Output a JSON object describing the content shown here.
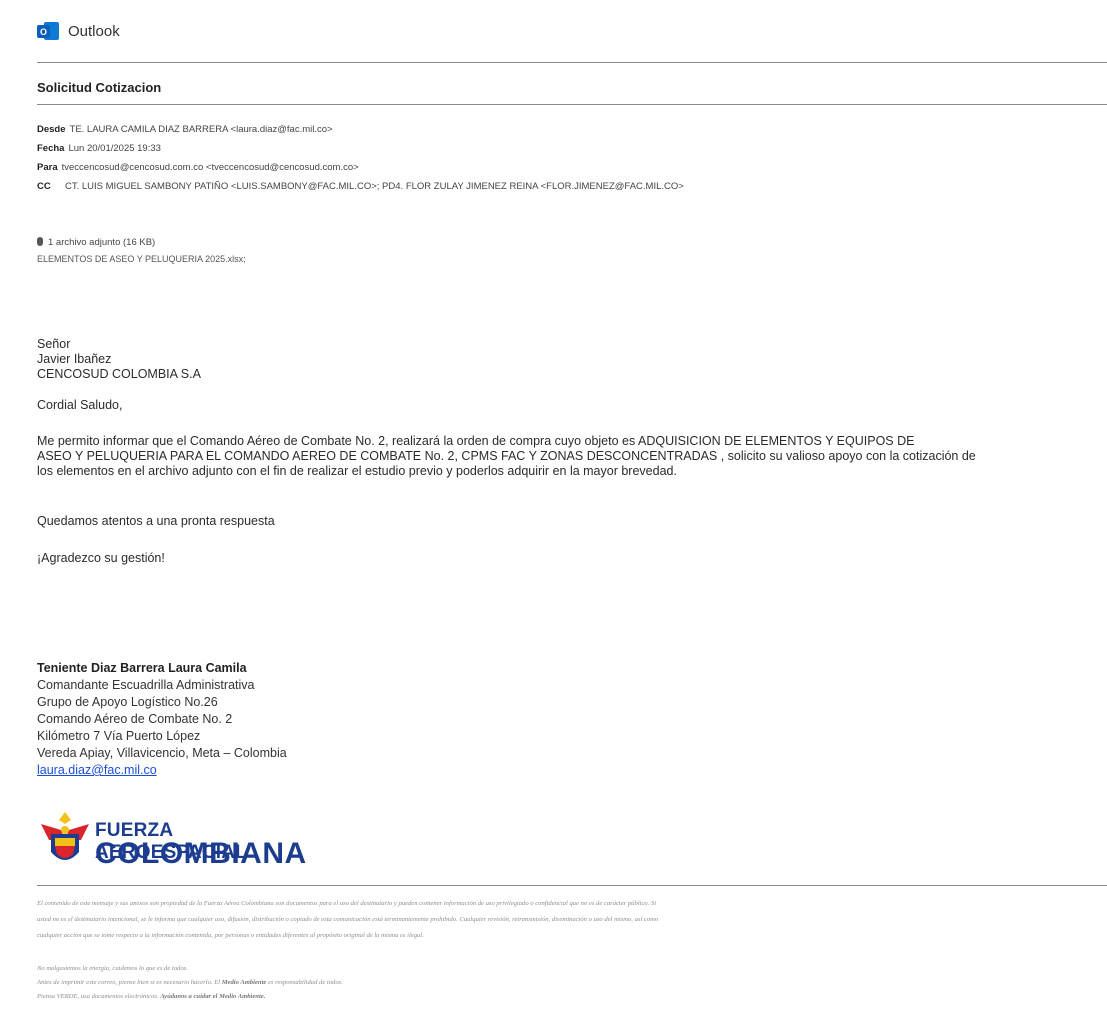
{
  "app": {
    "title": "Outlook",
    "icon": "outlook-icon",
    "icon_letter": "O"
  },
  "email": {
    "subject": "Solicitud Cotizacion",
    "headers": {
      "from_label": "Desde",
      "from_value": "TE. LAURA CAMILA DIAZ BARRERA <laura.diaz@fac.mil.co>",
      "date_label": "Fecha",
      "date_value": "Lun 20/01/2025 19:33",
      "to_label": "Para",
      "to_value": "tveccencosud@cencosud.com.co <tveccencosud@cencosud.com.co>",
      "cc_label": "CC",
      "cc_value": "CT. LUIS MIGUEL SAMBONY PATIÑO <LUIS.SAMBONY@FAC.MIL.CO>; PD4. FLOR ZULAY JIMENEZ REINA <FLOR.JIMENEZ@FAC.MIL.CO>"
    },
    "attachment": {
      "icon": "paperclip-icon",
      "summary": "1 archivo adjunto (16 KB)",
      "filename": "ELEMENTOS DE ASEO Y PELUQUERIA 2025.xlsx;"
    },
    "body": {
      "salutation_1": "Señor",
      "salutation_2": "Javier Ibañez",
      "salutation_3": "CENCOSUD COLOMBIA S.A",
      "greeting": "Cordial Saludo,",
      "paragraph_line_1": "Me permito informar que el Comando Aéreo de Combate No. 2, realizará la orden de compra cuyo objeto es ADQUISICION DE ELEMENTOS Y EQUIPOS DE",
      "paragraph_line_2": "ASEO Y PELUQUERIA PARA EL COMANDO AEREO DE COMBATE No. 2, CPMS FAC Y ZONAS DESCONCENTRADAS , solicito su valioso apoyo con la cotización de",
      "paragraph_line_3": "los elementos en el archivo adjunto con el fin de realizar el estudio previo y poderlos adquirir en la mayor brevedad.",
      "closing_1": "Quedamos atentos a una pronta respuesta",
      "closing_2": "¡Agradezco su gestión!"
    },
    "signature": {
      "name": "Teniente Diaz Barrera Laura Camila",
      "line_1": "Comandante Escuadrilla Administrativa",
      "line_2": "Grupo de Apoyo Logístico No.26",
      "line_3": "Comando Aéreo de Combate No. 2",
      "line_4": "Kilómetro 7 Vía Puerto López",
      "line_5": "Vereda Apiay, Villavicencio, Meta – Colombia",
      "email": "laura.diaz@fac.mil.co",
      "logo_line_1": "FUERZA AEROESPACIAL",
      "logo_line_2": "COLOMBIANA"
    },
    "disclaimer": {
      "line_1": "El contenido de este mensaje y sus anexos son propiedad de la Fuerza Aérea Colombiana son documentos para el uso del destinatario y pueden contener información de uso privilegiado o confidencial que no es de carácter público. Si",
      "line_2": "usted no es el destinatario intencional, se le informa que cualquier uso, difusión, distribución o copiado de esta comunicación está terminantemente prohibido. Cualquier revisión, retransmisión, diseminación o uso del mismo, así como",
      "line_3": "cualquier acción que se tome respecto a la información contenida, por personas o entidades diferentes al propósito original de la misma es ilegal."
    },
    "eco": {
      "line_1": "No malgastemos la energía, cuidemos lo que es de todos.",
      "line_2_a": "Antes de imprimir este correo, piense bien si es necesario hacerlo. El ",
      "line_2_b": "Medio Ambiente",
      "line_2_c": " es responsabilidad de todos.",
      "line_3_a": "Piensa VERDE, usa documentos electrónicos. ",
      "line_3_b": "Ayúdanos  a cuidar el Medio Ambiente."
    }
  }
}
